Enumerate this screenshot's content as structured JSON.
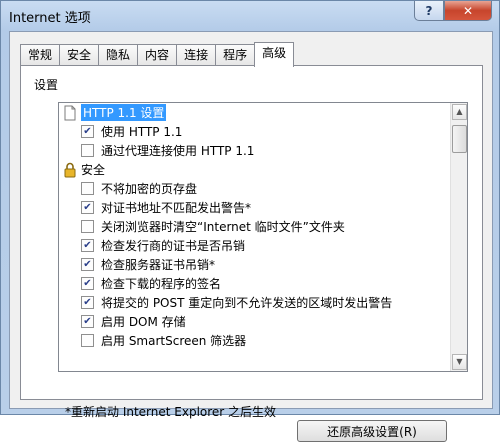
{
  "window": {
    "title": "Internet 选项",
    "help_label": "?",
    "close_label": "✕"
  },
  "tabs": [
    {
      "label": "常规"
    },
    {
      "label": "安全"
    },
    {
      "label": "隐私"
    },
    {
      "label": "内容"
    },
    {
      "label": "连接"
    },
    {
      "label": "程序"
    },
    {
      "label": "高级"
    }
  ],
  "active_tab": "高级",
  "settings": {
    "group_label": "设置",
    "items": [
      {
        "kind": "category",
        "icon": "page-icon",
        "label": "HTTP 1.1 设置",
        "selected": true
      },
      {
        "kind": "option",
        "label": "使用 HTTP 1.1",
        "checked": true
      },
      {
        "kind": "option",
        "label": "通过代理连接使用 HTTP 1.1",
        "checked": false
      },
      {
        "kind": "category",
        "icon": "lock-icon",
        "label": "安全",
        "selected": false
      },
      {
        "kind": "option",
        "label": "不将加密的页存盘",
        "checked": false
      },
      {
        "kind": "option",
        "label": "对证书地址不匹配发出警告*",
        "checked": true
      },
      {
        "kind": "option",
        "label": "关闭浏览器时清空“Internet 临时文件”文件夹",
        "checked": false
      },
      {
        "kind": "option",
        "label": "检查发行商的证书是否吊销",
        "checked": true
      },
      {
        "kind": "option",
        "label": "检查服务器证书吊销*",
        "checked": true
      },
      {
        "kind": "option",
        "label": "检查下载的程序的签名",
        "checked": true
      },
      {
        "kind": "option",
        "label": "将提交的 POST 重定向到不允许发送的区域时发出警告",
        "checked": true
      },
      {
        "kind": "option",
        "label": "启用 DOM 存储",
        "checked": true
      },
      {
        "kind": "option",
        "label": "启用 SmartScreen 筛选器",
        "checked": false
      }
    ]
  },
  "footer": {
    "restart_note": "*重新启动 Internet Explorer 之后生效",
    "reset_label": "还原高级设置(R)"
  },
  "colors": {
    "annotation_arrow": "#e0141a",
    "selection": "#3399ff"
  }
}
